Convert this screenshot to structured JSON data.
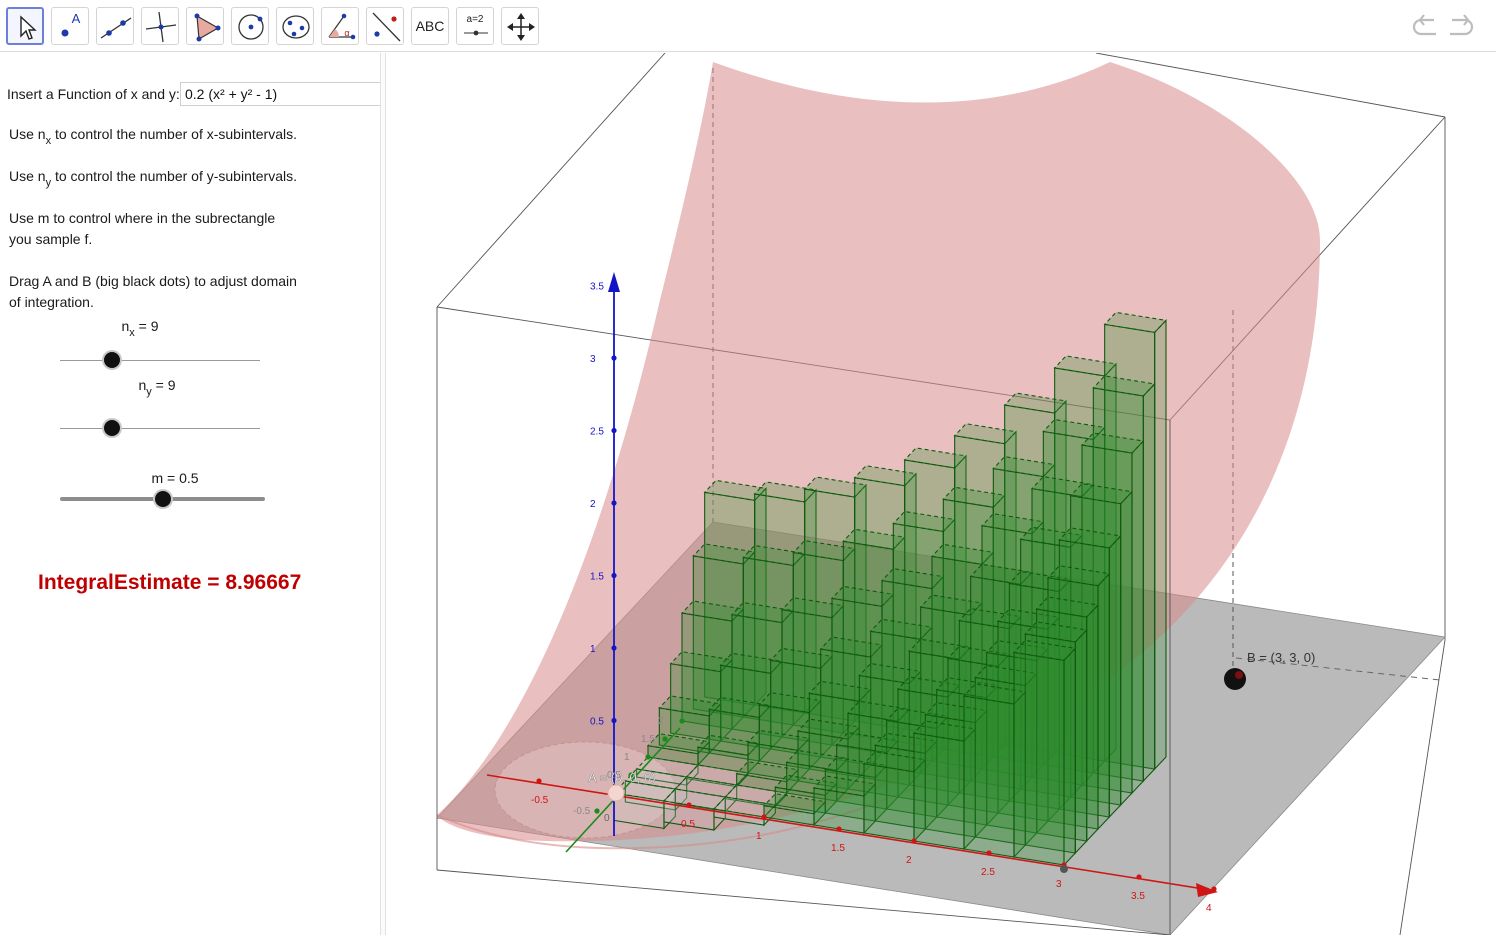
{
  "toolbar": {
    "tools": [
      {
        "name": "move-tool",
        "label": ""
      },
      {
        "name": "point-tool",
        "label": "A"
      },
      {
        "name": "line-tool",
        "label": ""
      },
      {
        "name": "perpendicular-line-tool",
        "label": ""
      },
      {
        "name": "polygon-tool",
        "label": ""
      },
      {
        "name": "circle-tool",
        "label": ""
      },
      {
        "name": "conic-tool",
        "label": ""
      },
      {
        "name": "angle-tool",
        "label": "α"
      },
      {
        "name": "reflect-tool",
        "label": ""
      },
      {
        "name": "text-tool",
        "label": "ABC"
      },
      {
        "name": "slider-tool",
        "label": "a=2"
      },
      {
        "name": "move-graphics-tool",
        "label": ""
      }
    ]
  },
  "panel": {
    "function_label": "Insert a Function of x and y:",
    "function_value": "0.2 (x² + y² - 1)",
    "nx_text": {
      "pre": "Use n",
      "sub": "x",
      "post": " to control the number of x-subintervals."
    },
    "ny_text": {
      "pre": "Use n",
      "sub": "y",
      "post": " to control the number of y-subintervals."
    },
    "m_text": [
      "Use m to control where in the subrectangle",
      "you sample f."
    ],
    "drag_text": [
      "Drag A and B (big black dots) to adjust domain",
      "of integration."
    ],
    "sliders": {
      "nx": {
        "name": "n",
        "sub": "x",
        "value": "9",
        "min": 1,
        "max": 30,
        "level": 0.26
      },
      "ny": {
        "name": "n",
        "sub": "y",
        "value": "9",
        "min": 1,
        "max": 30,
        "level": 0.26
      },
      "m": {
        "name": "m",
        "value": "0.5",
        "level": 0.5
      }
    },
    "integral": {
      "name": "IntegralEstimate",
      "eq": "=",
      "value": "8.96667"
    }
  },
  "view3d": {
    "function": "0.2 (x² + y² - 1)",
    "nx": 9,
    "ny": 9,
    "m": 0.5,
    "domain": {
      "x": [
        0,
        3
      ],
      "y": [
        0,
        3
      ]
    },
    "point_A": "A = (0, 0, 0)",
    "point_B": "B = (3, 3, 0)",
    "x_ticks": [
      "-0.5",
      "0.5",
      "1",
      "1.5",
      "2",
      "2.5",
      "3",
      "3.5",
      "4"
    ],
    "y_ticks": [
      "-0.5",
      "0.5",
      "1",
      "1.5",
      "2"
    ],
    "z_ticks": [
      "0.5",
      "1",
      "1.5",
      "2",
      "2.5",
      "3",
      "3.5"
    ],
    "origin": "0",
    "colors": {
      "surface": "#d98a8a",
      "boxes": "#2e8b2e",
      "box_edges": "#0f5a0f",
      "x_axis": "#d01515",
      "y_axis": "#1a8a1a",
      "z_axis": "#1515c8",
      "plane": "#b6b6b6"
    }
  }
}
